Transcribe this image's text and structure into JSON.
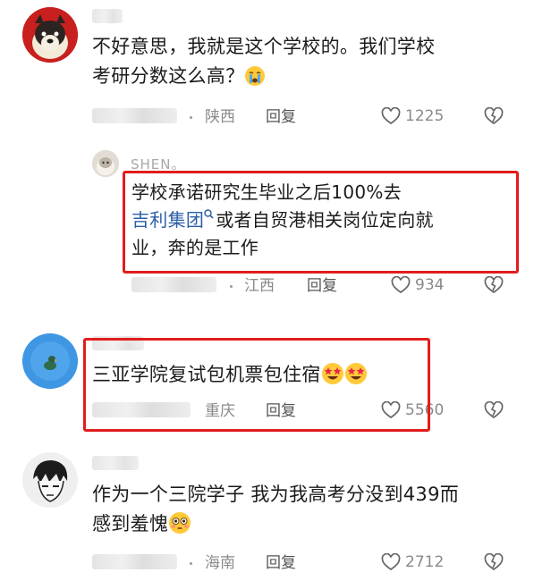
{
  "comments": [
    {
      "line1": "不好意思，我就是这个学校的。我们学校",
      "line2": "考研分数这么高？",
      "emoji": "crying-face",
      "location": "陕西",
      "reply_label": "回复",
      "likes": "1225"
    },
    {
      "username": "SHEN。",
      "line1": "学校承诺研究生毕业之后100%去",
      "link_text": "吉利集团",
      "line2_rest": "或者自贸港相关岗位定向就",
      "line3": "业，奔的是工作",
      "location": "江西",
      "reply_label": "回复",
      "likes": "934"
    },
    {
      "line1": "三亚学院复试包机票包住宿",
      "emoji": "star-struck-face",
      "location": "重庆",
      "reply_label": "回复",
      "likes": "5560"
    },
    {
      "line1": "作为一个三院学子 我为我高考分没到439而",
      "line2": "感到羞愧",
      "emoji": "flushed-face",
      "location": "海南",
      "reply_label": "回复",
      "likes": "2712"
    }
  ],
  "colors": {
    "highlight_box": "#e11d1d",
    "link": "#2b5fa8",
    "meta": "#8a8a8a"
  }
}
